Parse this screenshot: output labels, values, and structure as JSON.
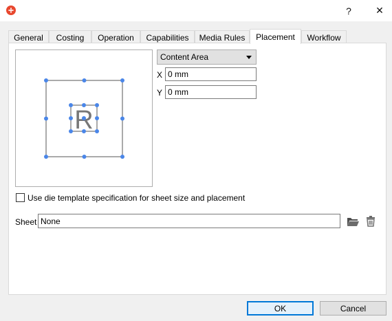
{
  "window": {
    "help_label": "?",
    "close_label": "✕",
    "app_icon": "app-logo-icon"
  },
  "tabs": [
    {
      "label": "General",
      "active": false
    },
    {
      "label": "Costing",
      "active": false
    },
    {
      "label": "Operation",
      "active": false
    },
    {
      "label": "Capabilities",
      "active": false
    },
    {
      "label": "Media Rules",
      "active": false
    },
    {
      "label": "Placement",
      "active": true
    },
    {
      "label": "Workflow",
      "active": false
    }
  ],
  "placement": {
    "preview_letter": "R",
    "area_select": "Content Area",
    "x_label": "X",
    "x_value": "0 mm",
    "y_label": "Y",
    "y_value": "0 mm",
    "die_template_checkbox": {
      "label": "Use die template specification for sheet size and placement",
      "checked": false
    },
    "sheet_label": "Sheet",
    "sheet_value": "None"
  },
  "buttons": {
    "ok": "OK",
    "cancel": "Cancel"
  },
  "colors": {
    "handle": "#4a86e8",
    "accent": "#0078d7",
    "app_icon": "#e8472e"
  },
  "icons": {
    "open": "folder-open-icon",
    "delete": "trash-icon"
  }
}
